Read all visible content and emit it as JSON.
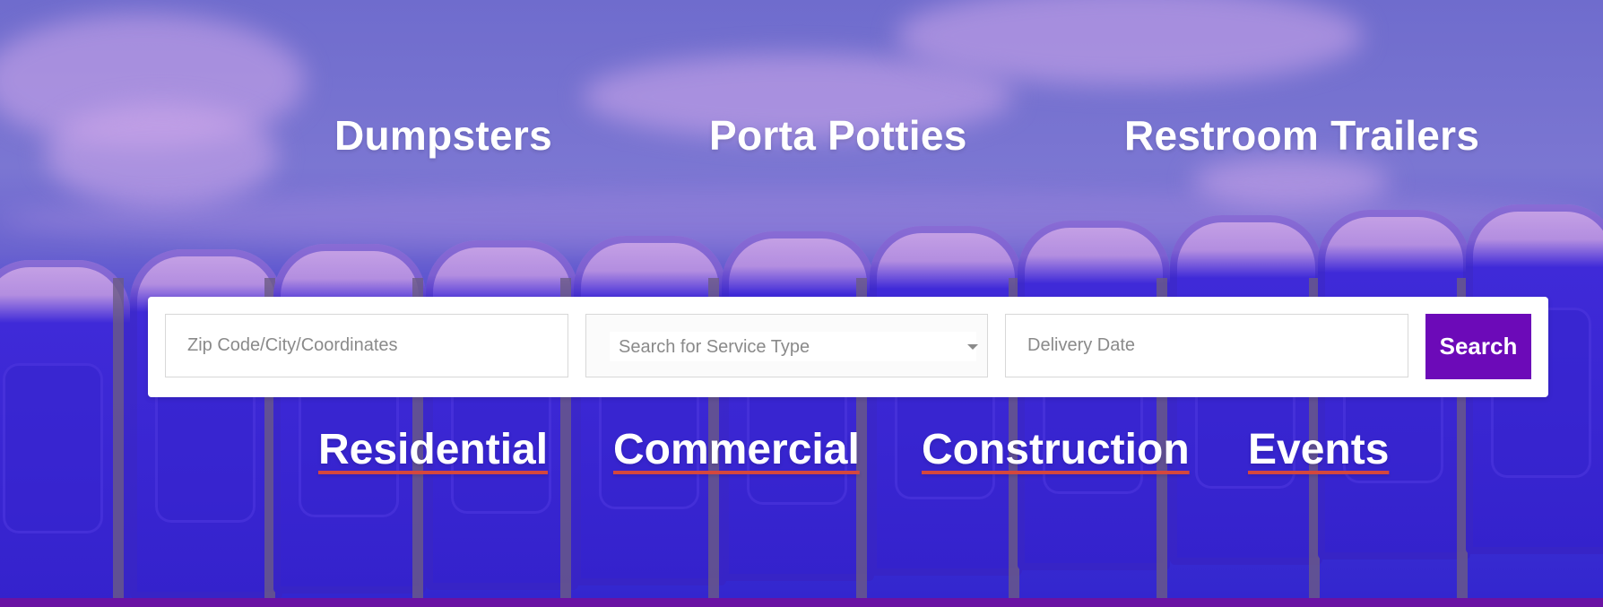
{
  "hero": {
    "services": [
      {
        "label": "Dumpsters"
      },
      {
        "label": "Porta Potties"
      },
      {
        "label": "Restroom Trailers"
      }
    ],
    "search": {
      "zip_placeholder": "Zip Code/City/Coordinates",
      "service_placeholder": "Search for Service Type",
      "date_placeholder": "Delivery Date",
      "button_label": "Search"
    },
    "segments": [
      {
        "label": "Residential"
      },
      {
        "label": "Commercial"
      },
      {
        "label": "Construction"
      },
      {
        "label": "Events"
      }
    ]
  },
  "colors": {
    "accent": "#6c0ab8",
    "underline": "#d5473d",
    "text": "#ffffff",
    "bottom_bar": "#6a12a3"
  },
  "icons": {
    "dropdown": "chevron-down-icon"
  }
}
